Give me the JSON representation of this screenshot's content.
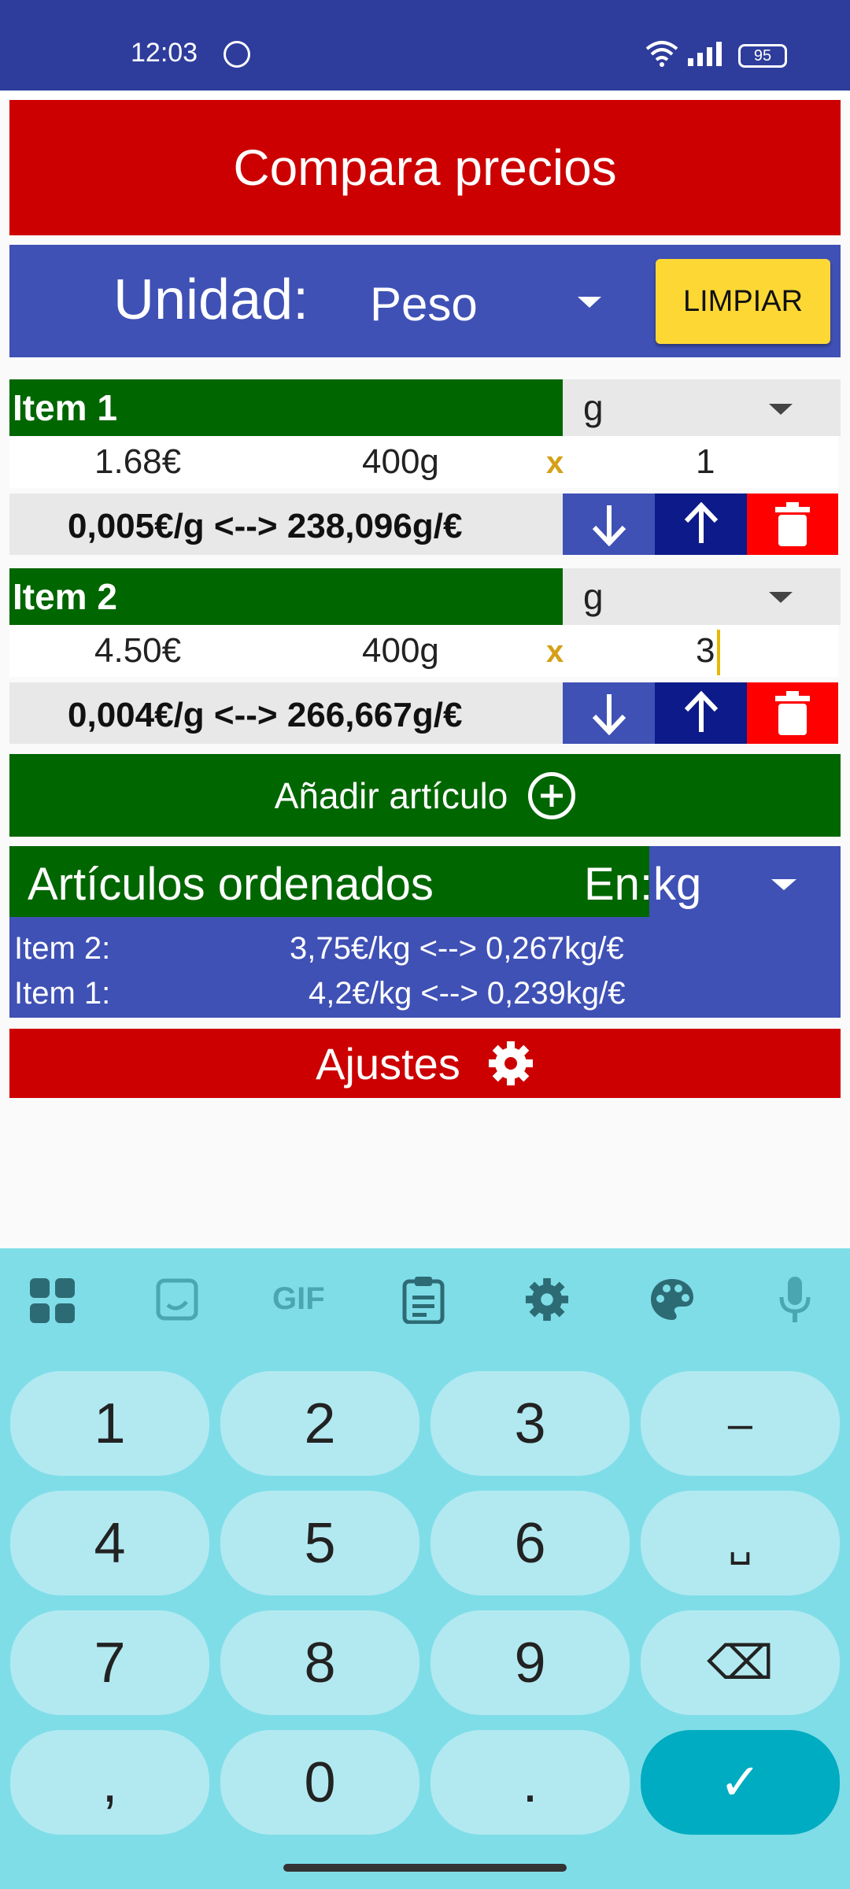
{
  "status": {
    "time": "12:03",
    "battery": "95"
  },
  "app": {
    "title": "Compara precios",
    "unit_label": "Unidad:",
    "unit_value": "Peso",
    "clear_label": "LIMPIAR"
  },
  "items": [
    {
      "name": "Item 1",
      "unit": "g",
      "price": "1.68€",
      "size": "400g",
      "times": "x",
      "qty": "1",
      "ratio": "0,005€/g <--> 238,096g/€"
    },
    {
      "name": "Item 2",
      "unit": "g",
      "price": "4.50€",
      "size": "400g",
      "times": "x",
      "qty": "3",
      "ratio": "0,004€/g <--> 266,667g/€"
    }
  ],
  "add_label": "Añadir artículo",
  "sorted": {
    "title": "Artículos ordenados",
    "in_label": "En:",
    "unit": "kg",
    "rows": [
      {
        "name": "Item 2:",
        "value": "3,75€/kg <--> 0,267kg/€"
      },
      {
        "name": "Item 1:",
        "value": "4,2€/kg <--> 0,239kg/€"
      }
    ]
  },
  "settings_label": "Ajustes",
  "keyboard": {
    "tools": [
      "apps-icon",
      "sticker-icon",
      "GIF",
      "clipboard-icon",
      "gear-icon",
      "palette-icon",
      "mic-icon"
    ],
    "gif_label": "GIF",
    "keys": [
      "1",
      "2",
      "3",
      "–",
      "4",
      "5",
      "6",
      "␣",
      "7",
      "8",
      "9",
      "⌫",
      ",",
      "0",
      ".",
      "✓"
    ]
  }
}
